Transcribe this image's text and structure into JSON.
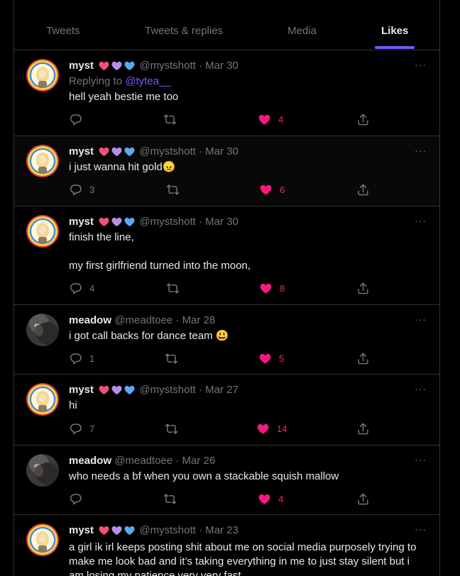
{
  "tabs": [
    {
      "label": "Tweets",
      "active": false
    },
    {
      "label": "Tweets & replies",
      "active": false
    },
    {
      "label": "Media",
      "active": false
    },
    {
      "label": "Likes",
      "active": true
    }
  ],
  "colors": {
    "accent": "#7856ff",
    "like": "#f91880",
    "muted": "#71767b",
    "text": "#e7e9ea",
    "border": "#2f3336"
  },
  "icons": {
    "reply": "reply-icon",
    "retweet": "retweet-icon",
    "like": "heart-filled-icon",
    "share": "share-icon",
    "more": "more-icon"
  },
  "tweets": [
    {
      "name": "myst",
      "badges": "💖💜💙",
      "handle": "@mystshott",
      "sep": "·",
      "date": "Mar 30",
      "reply_prefix": "Replying to",
      "reply_to": "@tytea__",
      "text": "hell yeah bestie me too",
      "replies": "",
      "retweets": "",
      "likes": "4",
      "more": "···"
    },
    {
      "name": "myst",
      "badges": "💖💜💙",
      "handle": "@mystshott",
      "sep": "·",
      "date": "Mar 30",
      "text": "i just wanna hit gold😠",
      "replies": "3",
      "retweets": "",
      "likes": "6",
      "more": "···"
    },
    {
      "name": "myst",
      "badges": "💖💜💙",
      "handle": "@mystshott",
      "sep": "·",
      "date": "Mar 30",
      "text": "finish the line,\n\nmy first girlfriend turned into the moon,",
      "replies": "4",
      "retweets": "",
      "likes": "8",
      "more": "···"
    },
    {
      "name": "meadow",
      "badges": "",
      "handle": "@meadtoee",
      "sep": "·",
      "date": "Mar 28",
      "text": "i got call backs for dance team 😃",
      "replies": "1",
      "retweets": "",
      "likes": "5",
      "more": "···"
    },
    {
      "name": "myst",
      "badges": "💖💜💙",
      "handle": "@mystshott",
      "sep": "·",
      "date": "Mar 27",
      "text": "hi",
      "replies": "7",
      "retweets": "",
      "likes": "14",
      "more": "···"
    },
    {
      "name": "meadow",
      "badges": "",
      "handle": "@meadtoee",
      "sep": "·",
      "date": "Mar 26",
      "text": "who needs a bf when you own a stackable squish mallow",
      "replies": "",
      "retweets": "",
      "likes": "4",
      "more": "···"
    },
    {
      "name": "myst",
      "badges": "💖💜💙",
      "handle": "@mystshott",
      "sep": "·",
      "date": "Mar 23",
      "text": "a girl ik irl keeps posting shit about me on social media purposely trying to make me look bad and it’s taking everything in me to just stay silent but i am losing my patience very very fast",
      "replies": "",
      "retweets": "",
      "likes": "",
      "more": "···"
    }
  ]
}
